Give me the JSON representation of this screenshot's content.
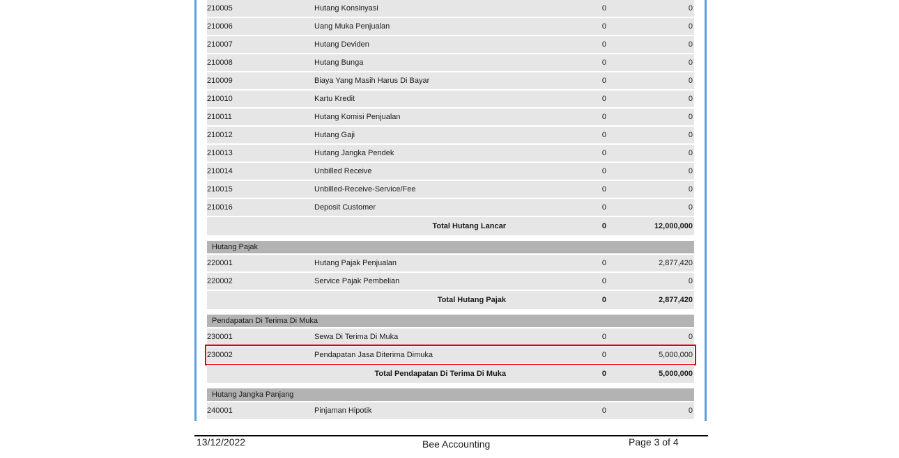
{
  "sections": [
    {
      "header": "",
      "rows": [
        {
          "code": "210005",
          "name": "Hutang Konsinyasi",
          "col1": "0",
          "col2": "0"
        },
        {
          "code": "210006",
          "name": "Uang Muka Penjualan",
          "col1": "0",
          "col2": "0"
        },
        {
          "code": "210007",
          "name": "Hutang Deviden",
          "col1": "0",
          "col2": "0"
        },
        {
          "code": "210008",
          "name": "Hutang Bunga",
          "col1": "0",
          "col2": "0"
        },
        {
          "code": "210009",
          "name": "Biaya Yang Masih Harus Di Bayar",
          "col1": "0",
          "col2": "0"
        },
        {
          "code": "210010",
          "name": "Kartu Kredit",
          "col1": "0",
          "col2": "0"
        },
        {
          "code": "210011",
          "name": "Hutang Komisi Penjualan",
          "col1": "0",
          "col2": "0"
        },
        {
          "code": "210012",
          "name": "Hutang Gaji",
          "col1": "0",
          "col2": "0"
        },
        {
          "code": "210013",
          "name": "Hutang Jangka Pendek",
          "col1": "0",
          "col2": "0"
        },
        {
          "code": "210014",
          "name": "Unbilled Receive",
          "col1": "0",
          "col2": "0"
        },
        {
          "code": "210015",
          "name": "Unbilled-Receive-Service/Fee",
          "col1": "0",
          "col2": "0"
        },
        {
          "code": "210016",
          "name": "Deposit Customer",
          "col1": "0",
          "col2": "0"
        }
      ],
      "total": {
        "label": "Total Hutang Lancar",
        "col1": "0",
        "col2": "12,000,000"
      }
    },
    {
      "header": "Hutang Pajak",
      "rows": [
        {
          "code": "220001",
          "name": "Hutang Pajak Penjualan",
          "col1": "0",
          "col2": "2,877,420"
        },
        {
          "code": "220002",
          "name": "Service Pajak Pembelian",
          "col1": "0",
          "col2": "0"
        }
      ],
      "total": {
        "label": "Total Hutang Pajak",
        "col1": "0",
        "col2": "2,877,420"
      }
    },
    {
      "header": "Pendapatan Di Terima Di Muka",
      "rows": [
        {
          "code": "230001",
          "name": "Sewa Di Terima Di Muka",
          "col1": "0",
          "col2": "0"
        },
        {
          "code": "230002",
          "name": "Pendapatan Jasa Diterima Dimuka",
          "col1": "0",
          "col2": "5,000,000",
          "highlighted": true
        }
      ],
      "total": {
        "label": "Total Pendapatan Di Terima Di Muka",
        "col1": "0",
        "col2": "5,000,000"
      }
    },
    {
      "header": "Hutang Jangka Panjang",
      "rows": [
        {
          "code": "240001",
          "name": "Pinjaman Hipotik",
          "col1": "0",
          "col2": "0"
        }
      ]
    }
  ],
  "footer": {
    "date": "13/12/2022",
    "app_name": "Bee Accounting",
    "page_label": "Page 3 of 4"
  },
  "colors": {
    "frame_border": "#5aa0e0",
    "row_bg": "#e6e6e6",
    "group_header_bg": "#b3b3b3",
    "highlight": "#e00000"
  }
}
